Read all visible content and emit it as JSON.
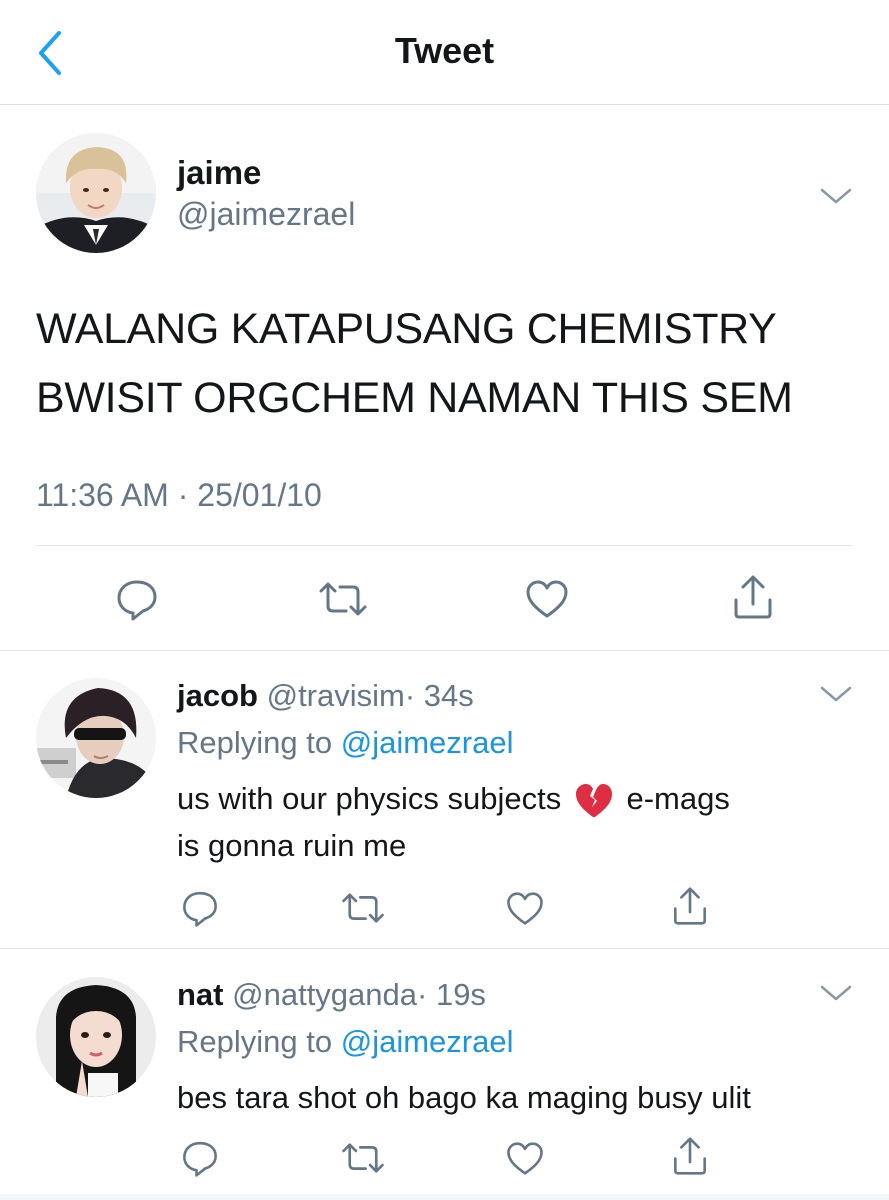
{
  "header": {
    "title": "Tweet",
    "back_icon": "chevron-left-icon",
    "accent": "#1da1f2"
  },
  "main_tweet": {
    "name": "jaime",
    "handle": "@jaimezrael",
    "text_line1": "WALANG KATAPUSANG CHEMISTRY",
    "text_line2": "BWISIT ORGCHEM NAMAN THIS SEM",
    "timestamp": "11:36 AM · 25/01/10",
    "menu_icon": "chevron-down-icon",
    "actions": [
      "reply-icon",
      "retweet-icon",
      "like-icon",
      "share-icon"
    ]
  },
  "replies": [
    {
      "name": "jacob",
      "handle": "@travisim",
      "time": "· 34s",
      "replying_label": "Replying to",
      "replying_to": "@jaimezrael",
      "text_before_emoji": "us with our physics subjects",
      "emoji": "broken-heart-emoji",
      "text_after_emoji": "e-mags",
      "text_line2": "is gonna ruin me"
    },
    {
      "name": "nat",
      "handle": "@nattyganda",
      "time": "· 19s",
      "replying_label": "Replying to",
      "replying_to": "@jaimezrael",
      "text": "bes tara shot oh bago ka maging busy ulit"
    }
  ],
  "colors": {
    "text_primary": "#14171a",
    "text_secondary": "#657786",
    "link": "#1b95e0",
    "divider": "#e1e8ed",
    "heart_red": "#dd2e44"
  }
}
